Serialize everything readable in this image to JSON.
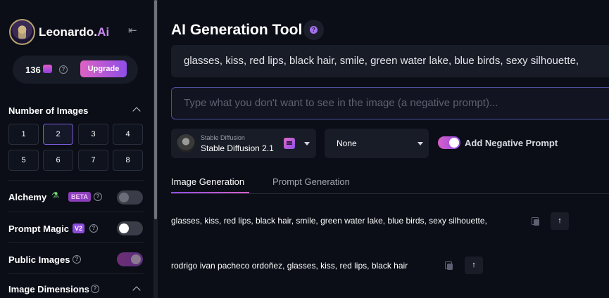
{
  "brand": {
    "name": "Leonardo.",
    "name_suffix": "Ai"
  },
  "credits": {
    "count": "136",
    "upgrade_label": "Upgrade",
    "help": "?"
  },
  "sidebar": {
    "number_of_images": {
      "title": "Number of Images",
      "options": [
        "1",
        "2",
        "3",
        "4",
        "5",
        "6",
        "7",
        "8"
      ],
      "selected": "2"
    },
    "alchemy": {
      "label": "Alchemy",
      "badge": "BETA",
      "help": "?",
      "enabled": false
    },
    "prompt_magic": {
      "label": "Prompt Magic",
      "badge": "V2",
      "help": "?",
      "enabled": false
    },
    "public_images": {
      "label": "Public Images",
      "help": "?",
      "enabled": true
    },
    "image_dimensions": {
      "label": "Image Dimensions",
      "help": "?"
    }
  },
  "main": {
    "title": "AI Generation Tool",
    "title_help": "?",
    "prompt": {
      "value": "glasses, kiss, red lips, black hair, smile, green water lake, blue birds, sexy silhouette,"
    },
    "negative_prompt": {
      "placeholder": "Type what you don't want to see in the image (a negative prompt)..."
    },
    "model": {
      "family": "Stable Diffusion",
      "name": "Stable Diffusion 2.1"
    },
    "preset": {
      "value": "None"
    },
    "add_negative_prompt": {
      "label": "Add Negative Prompt",
      "enabled": true
    },
    "tabs": [
      {
        "label": "Image Generation",
        "active": true
      },
      {
        "label": "Prompt Generation",
        "active": false
      }
    ],
    "history": [
      {
        "text": "glasses, kiss, red lips, black hair, smile, green water lake, blue birds, sexy silhouette,"
      },
      {
        "text": "rodrigo ivan pacheco ordoñez, glasses, kiss, red lips, black hair"
      }
    ],
    "upload_arrow": "↑"
  },
  "colors": {
    "background": "#0b0e17",
    "panel": "#181c27",
    "accent_pink": "#d85ec8",
    "accent_purple": "#8e4be3",
    "brand_ai": "#c98af0"
  },
  "icons": {
    "collapse": "collapse-sidebar-icon",
    "token": "token-stack-icon",
    "flask": "flask-icon",
    "copy": "copy-icon",
    "upload": "arrow-up-icon"
  }
}
